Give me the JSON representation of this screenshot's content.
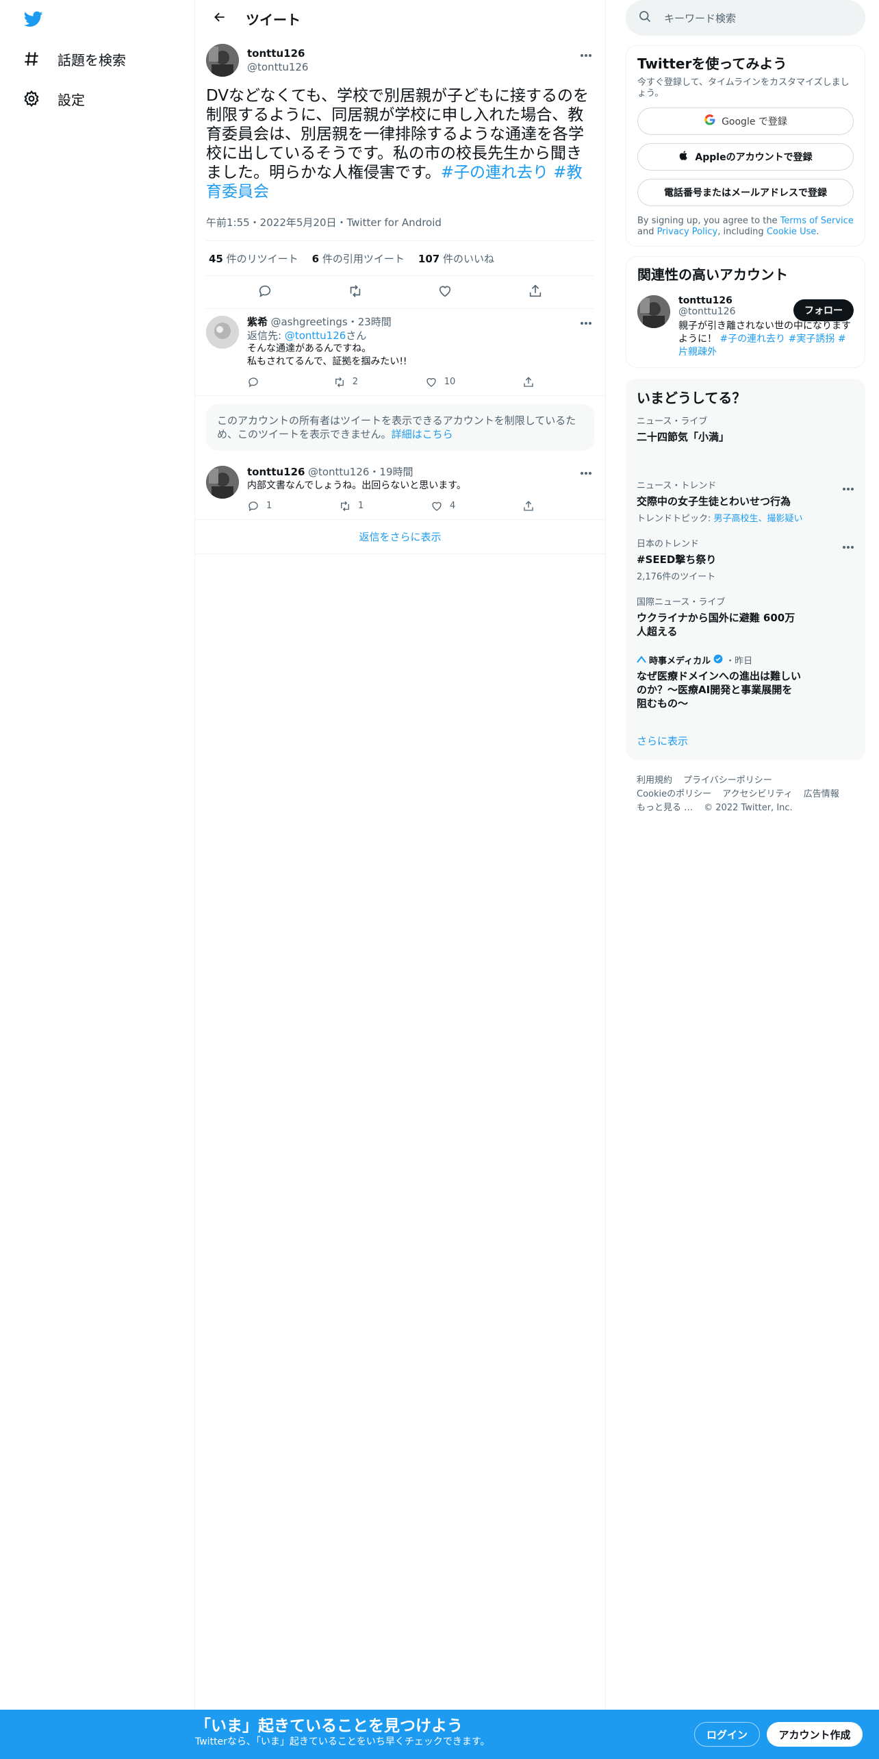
{
  "nav": {
    "items": [
      {
        "label": "話題を検索",
        "icon": "hashtag-icon"
      },
      {
        "label": "設定",
        "icon": "gear-icon"
      }
    ]
  },
  "header": {
    "title": "ツイート"
  },
  "tweet": {
    "display_name": "tonttu126",
    "handle": "@tonttu126",
    "text": "DVなどなくても、学校で別居親が子どもに接するのを制限するように、同居親が学校に申し入れた場合、教育委員会は、別居親を一律排除するような通達を各学校に出しているそうです。私の市の校長先生から聞きました。明らかな人権侵害です。",
    "hashtags": [
      "#子の連れ去り",
      "#教育委員会"
    ],
    "meta": "午前1:55・2022年5月20日・Twitter for Android",
    "retweets_count": "45",
    "retweets_label": "件のリツイート",
    "quotes_count": "6",
    "quotes_label": "件の引用ツイート",
    "likes_count": "107",
    "likes_label": "件のいいね"
  },
  "replies": [
    {
      "display_name": "紫希",
      "handle": "@ashgreetings",
      "time": "・23時間",
      "reply_to_prefix": "返信先: ",
      "reply_to_handle": "@tonttu126",
      "reply_to_suffix": "さん",
      "text_line1": "そんな通達があるんですね。",
      "text_line2": "私もされてるんで、証拠を掴みたい!!",
      "reply_count": "",
      "retweet_count": "2",
      "like_count": "10"
    },
    {
      "display_name": "tonttu126",
      "handle": "@tonttu126",
      "time": "・19時間",
      "text_line1": "内部文書なんでしょうね。出回らないと思います。",
      "reply_count": "1",
      "retweet_count": "1",
      "like_count": "4"
    }
  ],
  "notice": {
    "text": "このアカウントの所有者はツイートを表示できるアカウントを制限しているため、このツイートを表示できません。",
    "link": "詳細はこちら"
  },
  "show_more_replies": "返信をさらに表示",
  "search": {
    "placeholder": "キーワード検索"
  },
  "signup": {
    "title": "Twitterを使ってみよう",
    "subtitle": "今すぐ登録して、タイムラインをカスタマイズしましょう。",
    "google_button": "Google で登録",
    "apple_button": "Appleのアカウントで登録",
    "phone_button": "電話番号またはメールアドレスで登録",
    "tos_prefix": "By signing up, you agree to the ",
    "tos_link": "Terms of Service",
    "tos_and": " and ",
    "privacy_link": "Privacy Policy",
    "including": ", including ",
    "cookie_link": "Cookie Use",
    "period": "."
  },
  "related": {
    "title": "関連性の高いアカウント",
    "display_name": "tonttu126",
    "handle": "@tonttu126",
    "follow_button": "フォロー",
    "bio_text": "親子が引き離されない世の中になりますように！",
    "bio_tags": [
      "#子の連れ去り",
      "#実子誘拐",
      "#片親疎外"
    ]
  },
  "trends": {
    "title": "いまどうしてる？",
    "items": [
      {
        "category": "ニュース・ライブ",
        "title": "二十四節気「小満」"
      },
      {
        "category": "ニュース・トレンド",
        "title": "交際中の女子生徒とわいせつ行為",
        "topic_prefix": "トレンドトピック: ",
        "topic_links": "男子高校生、撮影疑い"
      },
      {
        "category": "日本のトレンド",
        "title": "#SEED撃ち祭り",
        "sub": "2,176件のツイート"
      },
      {
        "category": "国際ニュース・ライブ",
        "title": "ウクライナから国外に避難 600万人超える"
      },
      {
        "source": "時事メディカル",
        "time": "・昨日",
        "title": "なぜ医療ドメインへの進出は難しいのか？～医療AI開発と事業展開を阻むもの～"
      }
    ],
    "show_more": "さらに表示"
  },
  "footer": {
    "links": [
      "利用規約",
      "プライバシーポリシー",
      "Cookieのポリシー",
      "アクセシビリティ",
      "広告情報",
      "もっと見る …"
    ],
    "copyright": "© 2022 Twitter, Inc."
  },
  "bottom_bar": {
    "title": "「いま」起きていることを見つけよう",
    "subtitle": "Twitterなら、「いま」起きていることをいち早くチェックできます。",
    "login": "ログイン",
    "signup": "アカウント作成"
  },
  "colors": {
    "accent": "#1d9bf0",
    "text": "#0f1419",
    "muted": "#536471",
    "border": "#eff3f4"
  }
}
